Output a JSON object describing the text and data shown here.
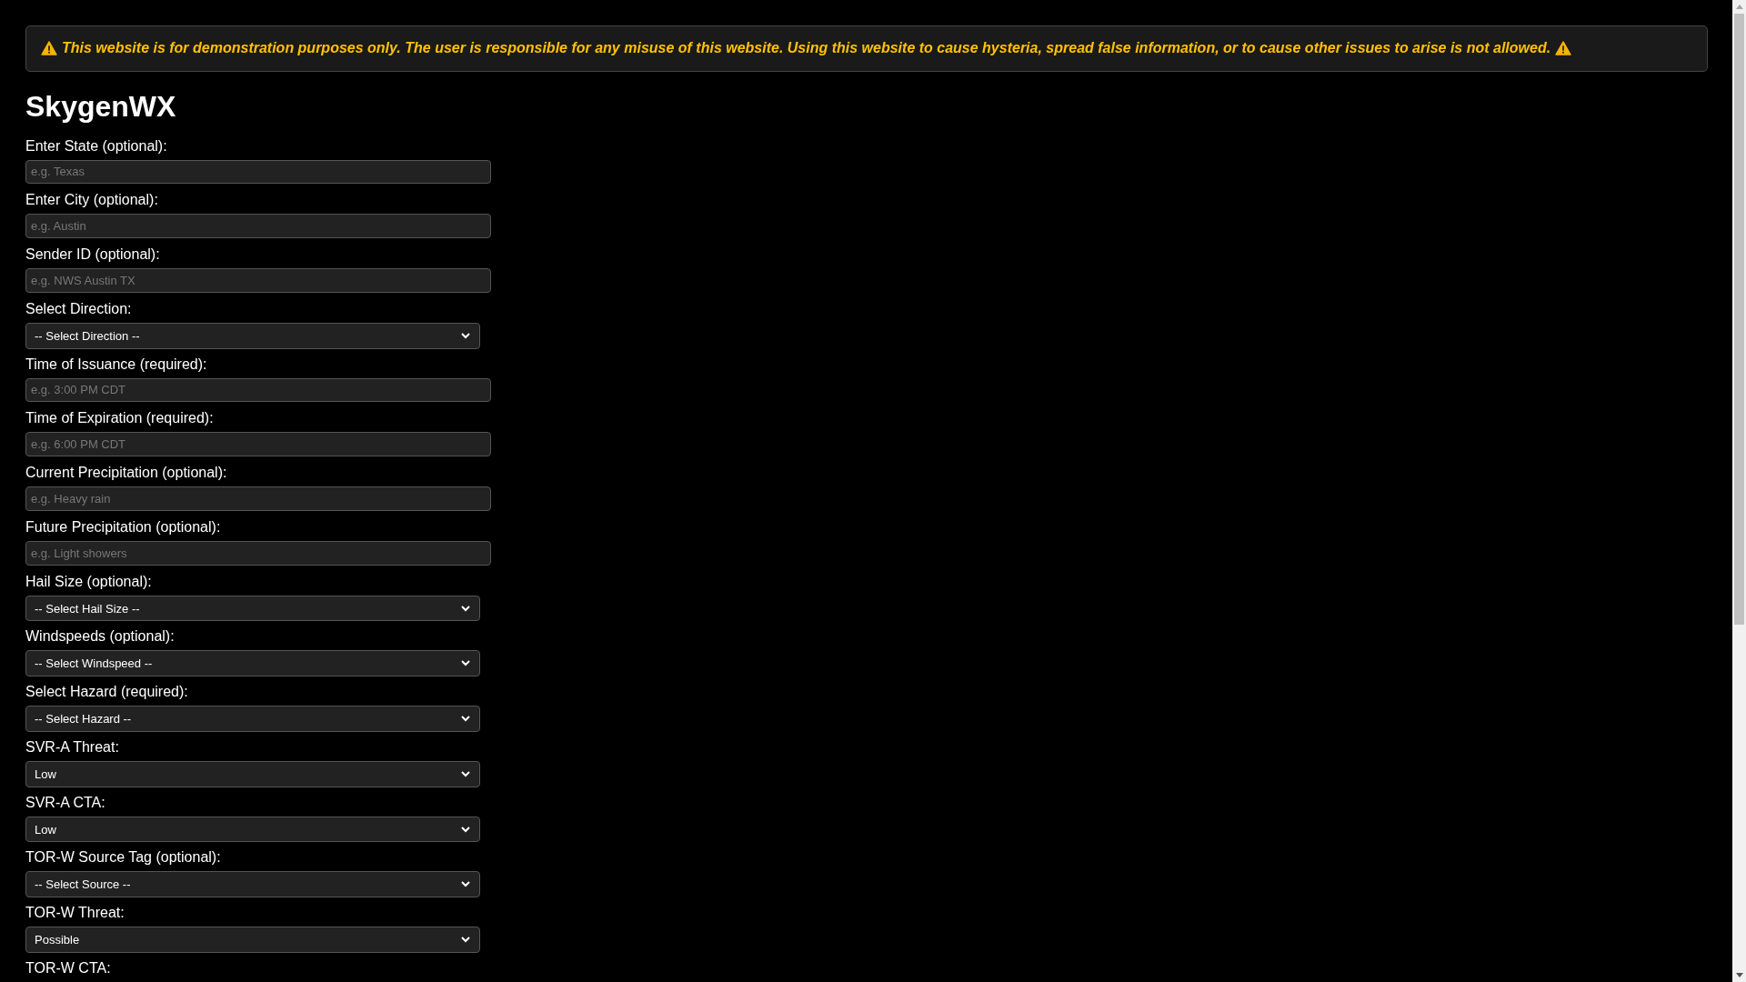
{
  "notice": {
    "text": "This website is for demonstration purposes only. The user is responsible for any misuse of this website. Using this website to cause hysteria, spread false information, or to cause other issues to arise is not allowed."
  },
  "title": "SkygenWX",
  "fields": [
    {
      "kind": "input",
      "label": "Enter State (optional):",
      "placeholder": "e.g. Texas"
    },
    {
      "kind": "input",
      "label": "Enter City (optional):",
      "placeholder": "e.g. Austin"
    },
    {
      "kind": "input",
      "label": "Sender ID (optional):",
      "placeholder": "e.g. NWS Austin TX"
    },
    {
      "kind": "select",
      "label": "Select Direction:",
      "value": "-- Select Direction --"
    },
    {
      "kind": "input",
      "label": "Time of Issuance (required):",
      "placeholder": "e.g. 3:00 PM CDT"
    },
    {
      "kind": "input",
      "label": "Time of Expiration (required):",
      "placeholder": "e.g. 6:00 PM CDT"
    },
    {
      "kind": "input",
      "label": "Current Precipitation (optional):",
      "placeholder": "e.g. Heavy rain"
    },
    {
      "kind": "input",
      "label": "Future Precipitation (optional):",
      "placeholder": "e.g. Light showers"
    },
    {
      "kind": "select",
      "label": "Hail Size (optional):",
      "value": "-- Select Hail Size --"
    },
    {
      "kind": "select",
      "label": "Windspeeds (optional):",
      "value": "-- Select Windspeed --"
    },
    {
      "kind": "select",
      "label": "Select Hazard (required):",
      "value": "-- Select Hazard --"
    },
    {
      "kind": "select",
      "label": "SVR-A Threat:",
      "value": "Low"
    },
    {
      "kind": "select",
      "label": "SVR-A CTA:",
      "value": "Low"
    },
    {
      "kind": "select",
      "label": "TOR-W Source Tag (optional):",
      "value": "-- Select Source --"
    },
    {
      "kind": "select",
      "label": "TOR-W Threat:",
      "value": "Possible"
    },
    {
      "kind": "label",
      "label": "TOR-W CTA:"
    }
  ]
}
